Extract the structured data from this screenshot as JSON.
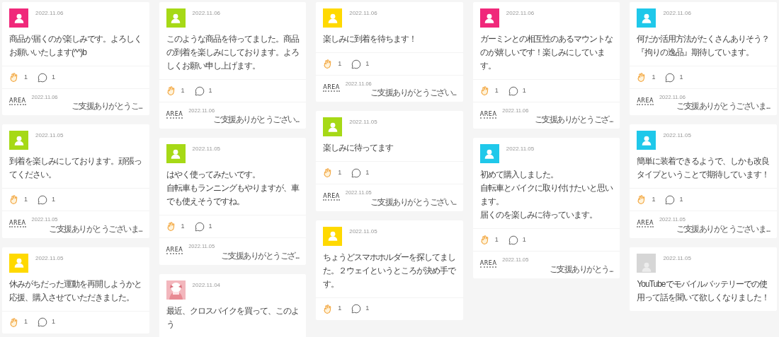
{
  "columns": [
    {
      "cards": [
        {
          "avatar": {
            "kind": "icon",
            "color": "#f0287a"
          },
          "date": "2022.11.06",
          "lines": [
            "商品が届くのが楽しみです。よろしくお願いいたします(^^)b"
          ],
          "claps": "1",
          "comments": "1",
          "reply": {
            "logo": "AREA",
            "date": "2022.11.06",
            "text": "ご支援ありがとうこ..."
          }
        },
        {
          "avatar": {
            "kind": "icon",
            "color": "#a6d916"
          },
          "date": "2022.11.05",
          "lines": [
            "到着を楽しみにしております。頑張ってください。"
          ],
          "claps": "1",
          "comments": "1",
          "reply": {
            "logo": "AREA",
            "date": "2022.11.05",
            "text": "ご支援ありがとうございま..."
          }
        },
        {
          "avatar": {
            "kind": "icon",
            "color": "#ffd900"
          },
          "date": "2022.11.05",
          "lines": [
            "休みがちだった運動を再開しようかと応援、購入させていただきました。"
          ],
          "claps": "1",
          "comments": "1"
        }
      ]
    },
    {
      "cards": [
        {
          "avatar": {
            "kind": "icon",
            "color": "#a6d916"
          },
          "date": "2022.11.06",
          "lines": [
            "このような商品を待ってました。商品の到着を楽しみにしております。よろしくお願い申し上げます。"
          ],
          "claps": "1",
          "comments": "1",
          "reply": {
            "logo": "AREA",
            "date": "2022.11.06",
            "text": "ご支援ありがとうござい..."
          }
        },
        {
          "avatar": {
            "kind": "icon",
            "color": "#a6d916"
          },
          "date": "2022.11.05",
          "lines": [
            "はやく使ってみたいです。",
            "自転車もランニングもやりますが、車でも使えそうですね。"
          ],
          "claps": "1",
          "comments": "1",
          "reply": {
            "logo": "AREA",
            "date": "2022.11.05",
            "text": "ご支援ありがとうござ..."
          }
        },
        {
          "avatar": {
            "kind": "picture"
          },
          "date": "2022.11.04",
          "lines": [
            "最近、クロスバイクを買って、このよう"
          ]
        }
      ]
    },
    {
      "cards": [
        {
          "avatar": {
            "kind": "icon",
            "color": "#ffd900"
          },
          "date": "2022.11.06",
          "lines": [
            "楽しみに到着を待ちます！"
          ],
          "claps": "1",
          "comments": "1",
          "reply": {
            "logo": "AREA",
            "date": "2022.11.06",
            "text": "ご支援ありがとうござい..."
          }
        },
        {
          "avatar": {
            "kind": "icon",
            "color": "#a6d916"
          },
          "date": "2022.11.05",
          "lines": [
            "楽しみに待ってます"
          ],
          "claps": "1",
          "comments": "1",
          "reply": {
            "logo": "AREA",
            "date": "2022.11.05",
            "text": "ご支援ありがとうござい..."
          }
        },
        {
          "avatar": {
            "kind": "icon",
            "color": "#ffd900"
          },
          "date": "2022.11.05",
          "lines": [
            "ちょうどスマホホルダーを探してました。２ウェイというところが決め手です。"
          ],
          "claps": "1",
          "comments": "1"
        }
      ]
    },
    {
      "cards": [
        {
          "avatar": {
            "kind": "icon",
            "color": "#f0287a"
          },
          "date": "2022.11.06",
          "lines": [
            "ガーミンとの相互性のあるマウントなのが嬉しいです！楽しみにしています。"
          ],
          "claps": "1",
          "comments": "1",
          "reply": {
            "logo": "AREA",
            "date": "2022.11.06",
            "text": "ご支援ありがとうござ..."
          }
        },
        {
          "avatar": {
            "kind": "icon",
            "color": "#1fc8ea"
          },
          "date": "2022.11.05",
          "lines": [
            "初めて購入しました。",
            "自転車とバイクに取り付けたいと思います。",
            "届くのを楽しみに待っています。"
          ],
          "claps": "1",
          "comments": "1",
          "reply": {
            "logo": "AREA",
            "date": "2022.11.05",
            "text": "ご支援ありがとう..."
          }
        }
      ]
    },
    {
      "cards": [
        {
          "avatar": {
            "kind": "icon",
            "color": "#1fc8ea"
          },
          "date": "2022.11.06",
          "lines": [
            "何だか活用方法がたくさんありそう？",
            "『拘りの逸品』期待しています。"
          ],
          "claps": "1",
          "comments": "1",
          "reply": {
            "logo": "AREA",
            "date": "2022.11.06",
            "text": "ご支援ありがとうございま..."
          }
        },
        {
          "avatar": {
            "kind": "icon",
            "color": "#1fc8ea"
          },
          "date": "2022.11.05",
          "lines": [
            "簡単に装着できるようで、しかも改良タイプということで期待しています！"
          ],
          "claps": "1",
          "comments": "1",
          "reply": {
            "logo": "AREA",
            "date": "2022.11.05",
            "text": "ご支援ありがとうございま..."
          }
        },
        {
          "avatar": {
            "kind": "silhouette"
          },
          "date": "2022.11.05",
          "lines": [
            "YouTubeでモバイルバッテリーでの使用って話を聞いて欲しくなりました！"
          ]
        }
      ]
    }
  ]
}
